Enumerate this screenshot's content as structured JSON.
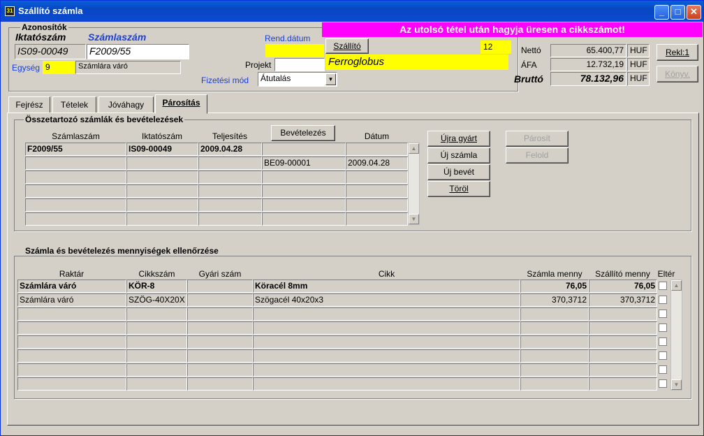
{
  "window": {
    "title": "Szállító számla"
  },
  "header": {
    "group_title": "Azonosítók",
    "iktatoszam_label": "Iktatószám",
    "szamlaszam_label": "Számlaszám",
    "iktatoszam_value": "IS09-00049",
    "szamlaszam_value": "F2009/55",
    "egyseg_label": "Egység",
    "egyseg_value": "9",
    "egyseg_name": "Számlára váró",
    "rend_datum_label": "Rend.dátum",
    "rend_datum_value": "",
    "projekt_label": "Projekt",
    "projekt_value": "",
    "fizetesi_mod_label": "Fizetési mód",
    "fizetesi_mod_value": "Átutalás",
    "warning": "Az utolsó tétel után hagyja üresen a cikkszámot!",
    "szallito_button": "Szállító",
    "szallito_code": "12",
    "szallito_name": "Ferroglobus"
  },
  "totals": {
    "netto_label": "Nettó",
    "netto_value": "65.400,77",
    "afa_label": "ÁFA",
    "afa_value": "12.732,19",
    "brutto_label": "Bruttó",
    "brutto_value": "78.132,96",
    "currency": "HUF"
  },
  "side_buttons": {
    "rekl": "Rekl:1",
    "konyv": "Könyv."
  },
  "tabs": [
    "Fejrész",
    "Tételek",
    "Jóváhagy",
    "Párosítás"
  ],
  "pairing": {
    "group_title": "Összetartozó számlák és bevételezések",
    "bevetelezes_button": "Bevételezés",
    "columns": [
      "Számlaszám",
      "Iktatószám",
      "Teljesítés",
      "",
      "Dátum"
    ],
    "rows": [
      [
        "F2009/55",
        "IS09-00049",
        "2009.04.28",
        "",
        ""
      ],
      [
        "",
        "",
        "",
        "BE09-00001",
        "2009.04.28"
      ],
      [
        "",
        "",
        "",
        "",
        ""
      ],
      [
        "",
        "",
        "",
        "",
        ""
      ],
      [
        "",
        "",
        "",
        "",
        ""
      ],
      [
        "",
        "",
        "",
        "",
        ""
      ]
    ],
    "buttons": {
      "ujra_gyart": "Újra gyárt",
      "uj_szamla": "Új számla",
      "uj_bevet": "Új bevét",
      "torol": "Töröl",
      "parosit": "Párosít",
      "felold": "Felold"
    }
  },
  "check": {
    "group_title": "Számla és bevételezés mennyiségek ellenőrzése",
    "columns": [
      "Raktár",
      "Cikkszám",
      "Gyári szám",
      "Cikk",
      "Számla menny",
      "Szállító menny",
      "Eltér"
    ],
    "rows": [
      [
        "Számlára váró",
        "KÖR-8",
        "",
        "Köracél 8mm",
        "76,05",
        "76,05"
      ],
      [
        "Számlára váró",
        "SZÖG-40X20X",
        "",
        "Szögacél 40x20x3",
        "370,3712",
        "370,3712"
      ],
      [
        "",
        "",
        "",
        "",
        "",
        ""
      ],
      [
        "",
        "",
        "",
        "",
        "",
        ""
      ],
      [
        "",
        "",
        "",
        "",
        "",
        ""
      ],
      [
        "",
        "",
        "",
        "",
        "",
        ""
      ],
      [
        "",
        "",
        "",
        "",
        "",
        ""
      ],
      [
        "",
        "",
        "",
        "",
        "",
        ""
      ]
    ]
  }
}
